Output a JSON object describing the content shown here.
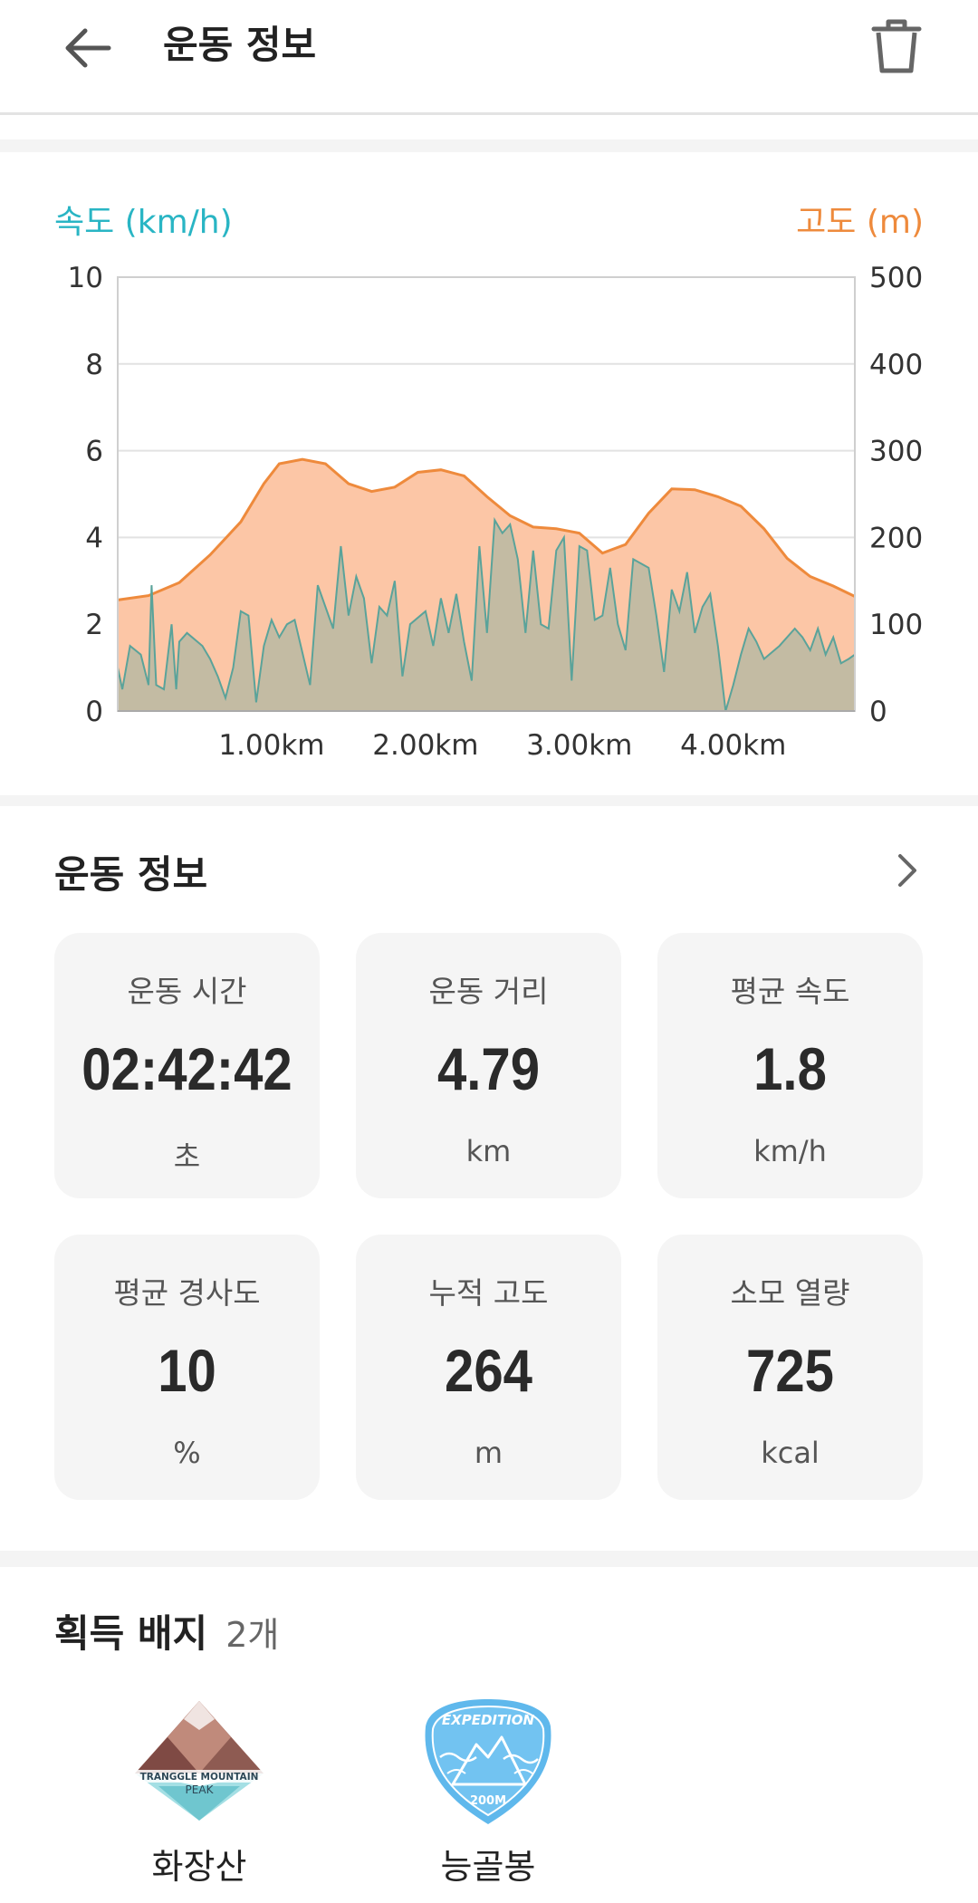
{
  "header": {
    "title": "운동 정보",
    "back_icon": "back-arrow-icon",
    "trash_icon": "trash-icon"
  },
  "chart": {
    "left_axis_title": "속도 (km/h)",
    "right_axis_title": "고도 (m)",
    "speed_color": "#29b5c4",
    "altitude_color": "#ee8a3c",
    "altitude_fill": "#fcc6a6",
    "speed_fill": "#b8b8a2"
  },
  "chart_data": {
    "type": "area",
    "xlabel": "",
    "x_tick_labels": [
      "1.00km",
      "2.00km",
      "3.00km",
      "4.00km"
    ],
    "x_ticks": [
      1.0,
      2.0,
      3.0,
      4.0
    ],
    "xlim": [
      0,
      4.79
    ],
    "y_left": {
      "label": "속도 (km/h)",
      "lim": [
        0,
        10
      ],
      "ticks": [
        0,
        2,
        4,
        6,
        8,
        10
      ]
    },
    "y_right": {
      "label": "고도 (m)",
      "lim": [
        0,
        500
      ],
      "ticks": [
        0,
        100,
        200,
        300,
        400,
        500
      ]
    },
    "grid": true,
    "series": [
      {
        "name": "고도 (m)",
        "axis": "right",
        "x": [
          0,
          0.2,
          0.4,
          0.6,
          0.8,
          0.95,
          1.05,
          1.2,
          1.35,
          1.5,
          1.65,
          1.8,
          1.95,
          2.1,
          2.25,
          2.4,
          2.55,
          2.7,
          2.85,
          3.0,
          3.15,
          3.3,
          3.45,
          3.6,
          3.75,
          3.9,
          4.05,
          4.2,
          4.35,
          4.5,
          4.65,
          4.79
        ],
        "values": [
          128,
          133,
          148,
          180,
          218,
          262,
          285,
          290,
          285,
          262,
          253,
          258,
          275,
          278,
          271,
          247,
          225,
          212,
          210,
          205,
          182,
          192,
          228,
          256,
          255,
          247,
          236,
          210,
          176,
          155,
          144,
          132
        ]
      },
      {
        "name": "속도 (km/h)",
        "axis": "left",
        "x": [
          0,
          0.03,
          0.08,
          0.15,
          0.2,
          0.22,
          0.25,
          0.3,
          0.35,
          0.38,
          0.4,
          0.45,
          0.55,
          0.6,
          0.65,
          0.7,
          0.75,
          0.8,
          0.85,
          0.9,
          0.95,
          1.0,
          1.05,
          1.1,
          1.15,
          1.25,
          1.3,
          1.4,
          1.45,
          1.5,
          1.55,
          1.6,
          1.65,
          1.7,
          1.75,
          1.8,
          1.85,
          1.9,
          2.0,
          2.05,
          2.1,
          2.15,
          2.2,
          2.25,
          2.3,
          2.35,
          2.4,
          2.45,
          2.5,
          2.55,
          2.6,
          2.65,
          2.7,
          2.75,
          2.8,
          2.85,
          2.9,
          2.95,
          3.0,
          3.05,
          3.1,
          3.15,
          3.2,
          3.25,
          3.3,
          3.35,
          3.4,
          3.45,
          3.5,
          3.55,
          3.6,
          3.65,
          3.7,
          3.75,
          3.8,
          3.85,
          3.9,
          3.95,
          4.0,
          4.05,
          4.1,
          4.15,
          4.2,
          4.3,
          4.4,
          4.45,
          4.5,
          4.55,
          4.6,
          4.65,
          4.7,
          4.75,
          4.79
        ],
        "values": [
          1.0,
          0.5,
          1.5,
          1.3,
          0.6,
          2.9,
          0.6,
          0.5,
          2.0,
          0.5,
          1.6,
          1.8,
          1.5,
          1.2,
          0.8,
          0.3,
          1.0,
          2.3,
          2.2,
          0.2,
          1.5,
          2.1,
          1.7,
          2.0,
          2.1,
          0.6,
          2.9,
          1.9,
          3.8,
          2.2,
          3.1,
          2.6,
          1.1,
          2.4,
          2.2,
          3.0,
          0.8,
          2.0,
          2.3,
          1.5,
          2.6,
          1.8,
          2.7,
          1.6,
          0.7,
          3.8,
          1.8,
          4.4,
          4.1,
          4.3,
          3.5,
          1.8,
          3.7,
          2.0,
          1.9,
          3.7,
          4.0,
          0.7,
          3.8,
          3.7,
          2.1,
          2.2,
          3.3,
          2.0,
          1.4,
          3.5,
          3.4,
          3.3,
          2.2,
          0.9,
          2.8,
          2.3,
          3.2,
          1.8,
          2.4,
          2.7,
          1.5,
          0.0,
          0.6,
          1.3,
          1.9,
          1.6,
          1.2,
          1.5,
          1.9,
          1.7,
          1.4,
          1.9,
          1.3,
          1.7,
          1.1,
          1.2,
          1.3
        ]
      }
    ]
  },
  "info": {
    "title": "운동 정보",
    "chevron_icon": "chevron-right-icon",
    "cards": [
      {
        "label": "운동 시간",
        "value": "02:42:42",
        "unit": "초"
      },
      {
        "label": "운동 거리",
        "value": "4.79",
        "unit": "km"
      },
      {
        "label": "평균 속도",
        "value": "1.8",
        "unit": "km/h"
      },
      {
        "label": "평균 경사도",
        "value": "10",
        "unit": "%"
      },
      {
        "label": "누적 고도",
        "value": "264",
        "unit": "m"
      },
      {
        "label": "소모 열량",
        "value": "725",
        "unit": "kcal"
      }
    ]
  },
  "badges": {
    "title": "획득 배지",
    "count": "2개",
    "items": [
      {
        "name": "화장산",
        "icon": "mountain-peak-badge-icon",
        "art_text": [
          "TRANGGLE MOUNTAIN",
          "PEAK"
        ]
      },
      {
        "name": "능골봉",
        "icon": "expedition-badge-icon",
        "art_text": [
          "EXPEDITION",
          "200M"
        ]
      }
    ]
  }
}
